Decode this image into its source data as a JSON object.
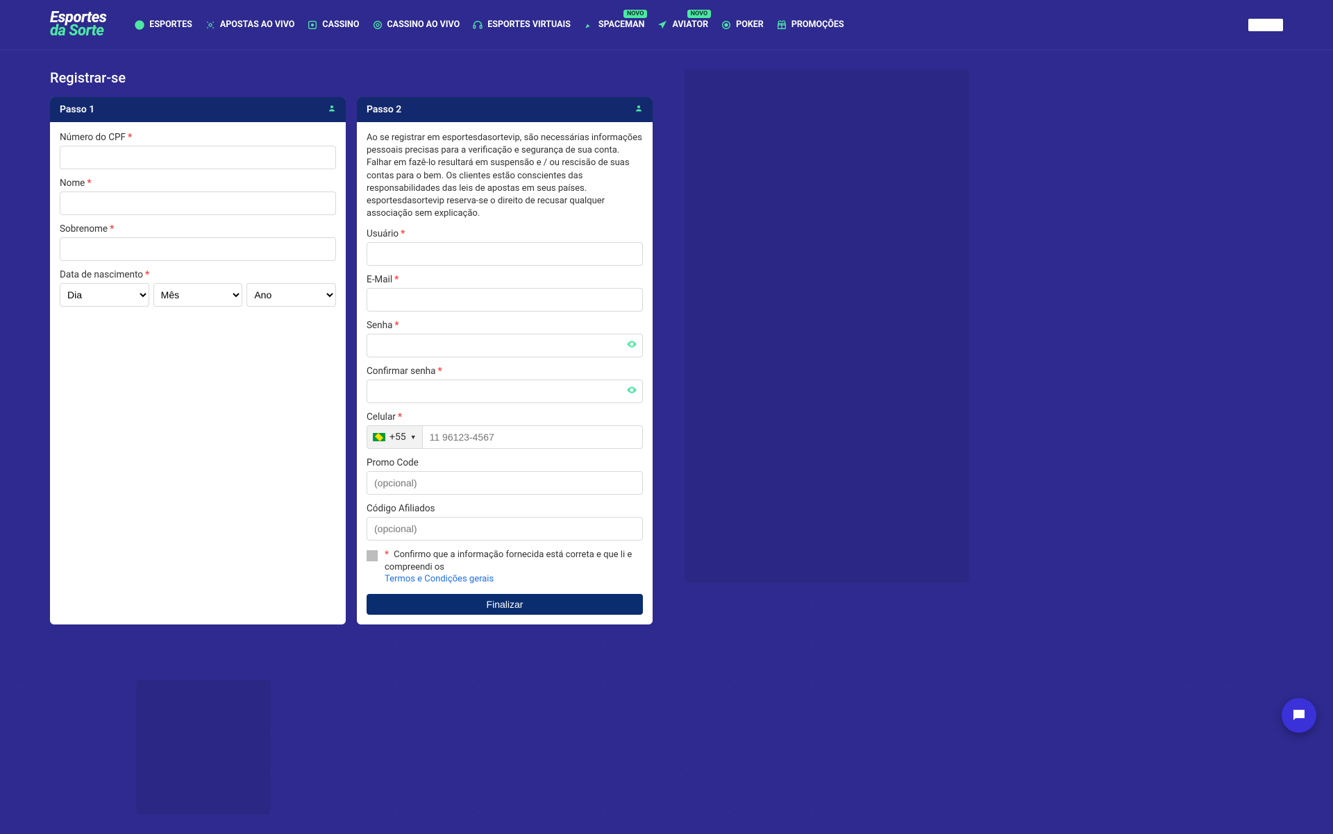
{
  "brand": {
    "top": "Esportes",
    "bottom": "da Sorte"
  },
  "nav": {
    "novo_badge": "Novo",
    "items": [
      {
        "label": "ESPORTES"
      },
      {
        "label": "APOSTAS AO VIVO"
      },
      {
        "label": "CASSINO"
      },
      {
        "label": "CASSINO AO VIVO"
      },
      {
        "label": "ESPORTES VIRTUAIS"
      },
      {
        "label": "SPACEMAN"
      },
      {
        "label": "AVIATOR"
      },
      {
        "label": "POKER"
      },
      {
        "label": "PROMOÇÕES"
      }
    ]
  },
  "page_title": "Registrar-se",
  "step1": {
    "title": "Passo 1",
    "cpf_label": "Número do CPF",
    "nome_label": "Nome",
    "sobrenome_label": "Sobrenome",
    "dob_label": "Data de nascimento",
    "dob_day": "Dia",
    "dob_month": "Mês",
    "dob_year": "Ano"
  },
  "step2": {
    "title": "Passo 2",
    "disclaimer": "Ao se registrar em esportesdasortevip, são necessárias informações pessoais precisas para a verificação e segurança de sua conta. Falhar em fazê-lo resultará em suspensão e / ou rescisão de suas contas para o bem. Os clientes estão conscientes das responsabilidades das leis de apostas em seus países. esportesdasortevip reserva-se o direito de recusar qualquer associação sem explicação.",
    "usuario_label": "Usuário",
    "email_label": "E-Mail",
    "senha_label": "Senha",
    "confirmar_label": "Confirmar senha",
    "celular_label": "Celular",
    "celular_prefix": "+55",
    "celular_placeholder": "11 96123-4567",
    "promo_label": "Promo Code",
    "promo_placeholder": "(opcional)",
    "afiliados_label": "Código Afiliados",
    "afiliados_placeholder": "(opcional)",
    "terms_text": "Confirmo que a informação fornecida está correta e que li e compreendi os",
    "terms_link": "Termos e Condições gerais",
    "finalize": "Finalizar"
  }
}
